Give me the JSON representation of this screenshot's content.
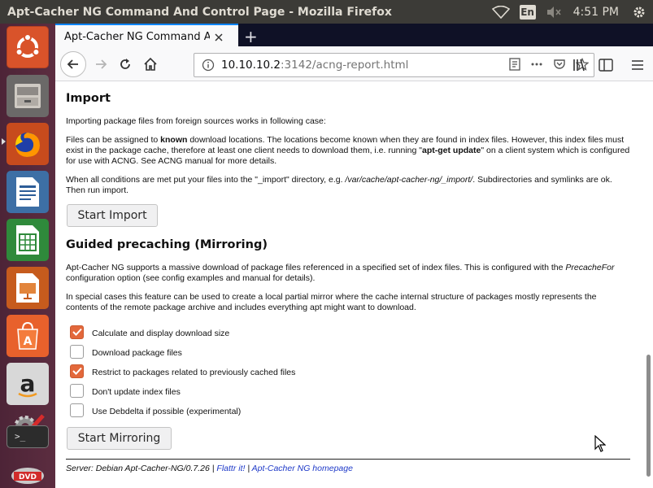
{
  "panel": {
    "window_title": "Apt-Cacher NG Command And Control Page - Mozilla Firefox",
    "keyboard_layout": "En",
    "clock": "4:51 PM"
  },
  "launcher": {
    "items": [
      "ubuntu-dash",
      "files",
      "firefox",
      "libreoffice-writer",
      "libreoffice-calc",
      "libreoffice-impress",
      "ubuntu-software",
      "amazon",
      "system-settings",
      "terminal",
      "dvd"
    ]
  },
  "browser": {
    "tab": {
      "label": "Apt-Cacher NG Command And Control Page"
    },
    "new_tab": "+",
    "url": {
      "host": "10.10.10.2",
      "rest": ":3142/acng-report.html"
    }
  },
  "page": {
    "import": {
      "heading": "Import",
      "p1": "Importing package files from foreign sources works in following case:",
      "p2_a": "Files can be assigned to ",
      "p2_b": "known",
      "p2_c": " download locations. The locations become known when they are found in index files. However, this index files must exist in the package cache, therefore at least one client needs to download them, i.e. running \"",
      "p2_d": "apt-get update",
      "p2_e": "\" on a client system which is configured for use with ACNG. See ACNG manual for more details.",
      "p3_a": "When all conditions are met put your files into the \"_import\" directory, e.g. ",
      "p3_b": "/var/cache/apt-cacher-ng/_import/",
      "p3_c": ". Subdirectories and symlinks are ok. Then run import.",
      "button": "Start Import"
    },
    "mirroring": {
      "heading": "Guided precaching (Mirroring)",
      "p1_a": "Apt-Cacher NG supports a massive download of package files referenced in a specified set of index files. This is configured with the ",
      "p1_b": "PrecacheFor",
      "p1_c": " configuration option (see config examples and manual for details).",
      "p2": "In special cases this feature can be used to create a local partial mirror where the cache internal structure of packages mostly represents the contents of the remote package archive and includes everything apt might want to download.",
      "options": [
        {
          "label": "Calculate and display download size",
          "checked": true
        },
        {
          "label": "Download package files",
          "checked": false
        },
        {
          "label": "Restrict to packages related to previously cached files",
          "checked": true
        },
        {
          "label": "Don't update index files",
          "checked": false
        },
        {
          "label": "Use Debdelta if possible (experimental)",
          "checked": false
        }
      ],
      "button": "Start Mirroring"
    },
    "footer": {
      "server": "Server: Debian Apt-Cacher-NG/0.7.26 | ",
      "flattr": "Flattr it!",
      "sep": " | ",
      "homepage": "Apt-Cacher NG homepage"
    }
  }
}
